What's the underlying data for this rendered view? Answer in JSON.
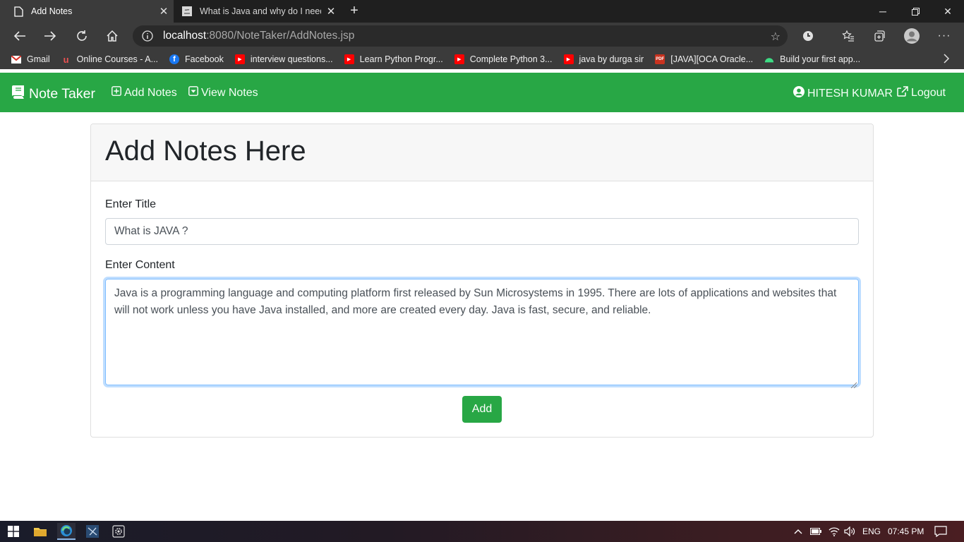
{
  "browser": {
    "tabs": [
      {
        "title": "Add Notes",
        "active": true
      },
      {
        "title": "What is Java and why do I need i",
        "active": false
      }
    ],
    "address": {
      "host": "localhost",
      "path": ":8080/NoteTaker/AddNotes.jsp"
    },
    "bookmarks": [
      {
        "label": "Gmail",
        "icon": "gmail-icon",
        "color": "#d93025"
      },
      {
        "label": "Online Courses - A...",
        "icon": "udemy-icon",
        "color": "#ec5252"
      },
      {
        "label": "Facebook",
        "icon": "facebook-icon",
        "color": "#1877f2"
      },
      {
        "label": "interview questions...",
        "icon": "youtube-icon",
        "color": "#ff0000"
      },
      {
        "label": "Learn Python Progr...",
        "icon": "youtube-icon",
        "color": "#ff0000"
      },
      {
        "label": "Complete Python 3...",
        "icon": "youtube-icon",
        "color": "#ff0000"
      },
      {
        "label": "java by durga sir",
        "icon": "youtube-icon",
        "color": "#ff0000"
      },
      {
        "label": "[JAVA][OCA Oracle...",
        "icon": "pdf-icon",
        "color": "#c8321f"
      },
      {
        "label": "Build your first app...",
        "icon": "android-icon",
        "color": "#3ddc84"
      }
    ]
  },
  "navbar": {
    "brand": "Note Taker",
    "links": [
      "Add Notes",
      "View Notes"
    ],
    "user": "HITESH KUMAR",
    "logout": "Logout",
    "color": "#28a745"
  },
  "card": {
    "heading": "Add Notes Here",
    "title_label": "Enter Title",
    "title_value": "What is JAVA ?",
    "content_label": "Enter Content",
    "content_value": "Java is a programming language and computing platform first released by Sun Microsystems in 1995. There are lots of applications and websites that will not work unless you have Java installed, and more are created every day. Java is fast, secure, and reliable.",
    "button": "Add"
  },
  "taskbar": {
    "lang": "ENG",
    "time": "07:45 PM"
  }
}
